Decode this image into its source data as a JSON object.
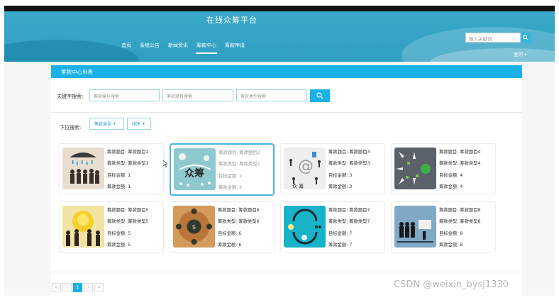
{
  "header": {
    "title": "在线众筹平台",
    "nav": [
      "首页",
      "系统公告",
      "新闻资讯",
      "筹款中心",
      "筹款申请"
    ],
    "active_nav": 3,
    "search_placeholder": "输入关键词",
    "my_menu": "我的 ▾"
  },
  "section": {
    "title": "筹款中心列表"
  },
  "filters": {
    "keyword_label": "关键字搜索:",
    "inputs": [
      "筹款编号搜索",
      "筹款题目搜索",
      "筹款类型搜索"
    ],
    "dropdown_label": "下拉搜索:",
    "dropdowns": [
      "筹款类型",
      "排序"
    ]
  },
  "cards": [
    {
      "title": "筹款题目: 筹款题目1",
      "type": "筹款类型: 筹款类型1",
      "target": "目标金额: 1",
      "raised": "筹款金额: 1",
      "image_icon": "rain-crowd-image"
    },
    {
      "title": "筹款题目: 筹款题目2",
      "type": "筹款类型: 筹款类型2",
      "target": "目标金额: 2",
      "raised": "筹款金额: 2",
      "image_icon": "zhongchou-text-image"
    },
    {
      "title": "筹款题目: 筹款题目3",
      "type": "筹款类型: 筹款类型3",
      "target": "目标金额: 3",
      "raised": "筹款金额: 3",
      "image_icon": "at-sign-people-image"
    },
    {
      "title": "筹款题目: 筹款题目4",
      "type": "筹款类型: 筹款类型4",
      "target": "目标金额: 4",
      "raised": "筹款金额: 4",
      "image_icon": "hands-money-image"
    },
    {
      "title": "筹款题目: 筹款题目5",
      "type": "筹款类型: 筹款类型5",
      "target": "目标金额: 5",
      "raised": "筹款金额: 5",
      "image_icon": "bulb-people-image"
    },
    {
      "title": "筹款题目: 筹款题目6",
      "type": "筹款类型: 筹款类型6",
      "target": "目标金额: 6",
      "raised": "筹款金额: 6",
      "image_icon": "money-bag-circle-image"
    },
    {
      "title": "筹款题目: 筹款题目7",
      "type": "筹款类型: 筹款类型7",
      "target": "目标金额: 7",
      "raised": "筹款金额: 7",
      "image_icon": "cycle-arrows-image"
    },
    {
      "title": "筹款题目: 筹款题目8",
      "type": "筹款类型: 筹款类型8",
      "target": "目标金额: 8",
      "raised": "筹款金额: 8",
      "image_icon": "crowd-screen-image"
    }
  ],
  "pagination": {
    "first": "«",
    "prev": "‹",
    "page": "1",
    "next": "›",
    "last": "»"
  },
  "watermark": "CSDN @weixin_bysj1330",
  "colors": {
    "accent": "#1ab0e8",
    "header": "#2f9fc2",
    "highlight_border": "#4ab6e0"
  }
}
